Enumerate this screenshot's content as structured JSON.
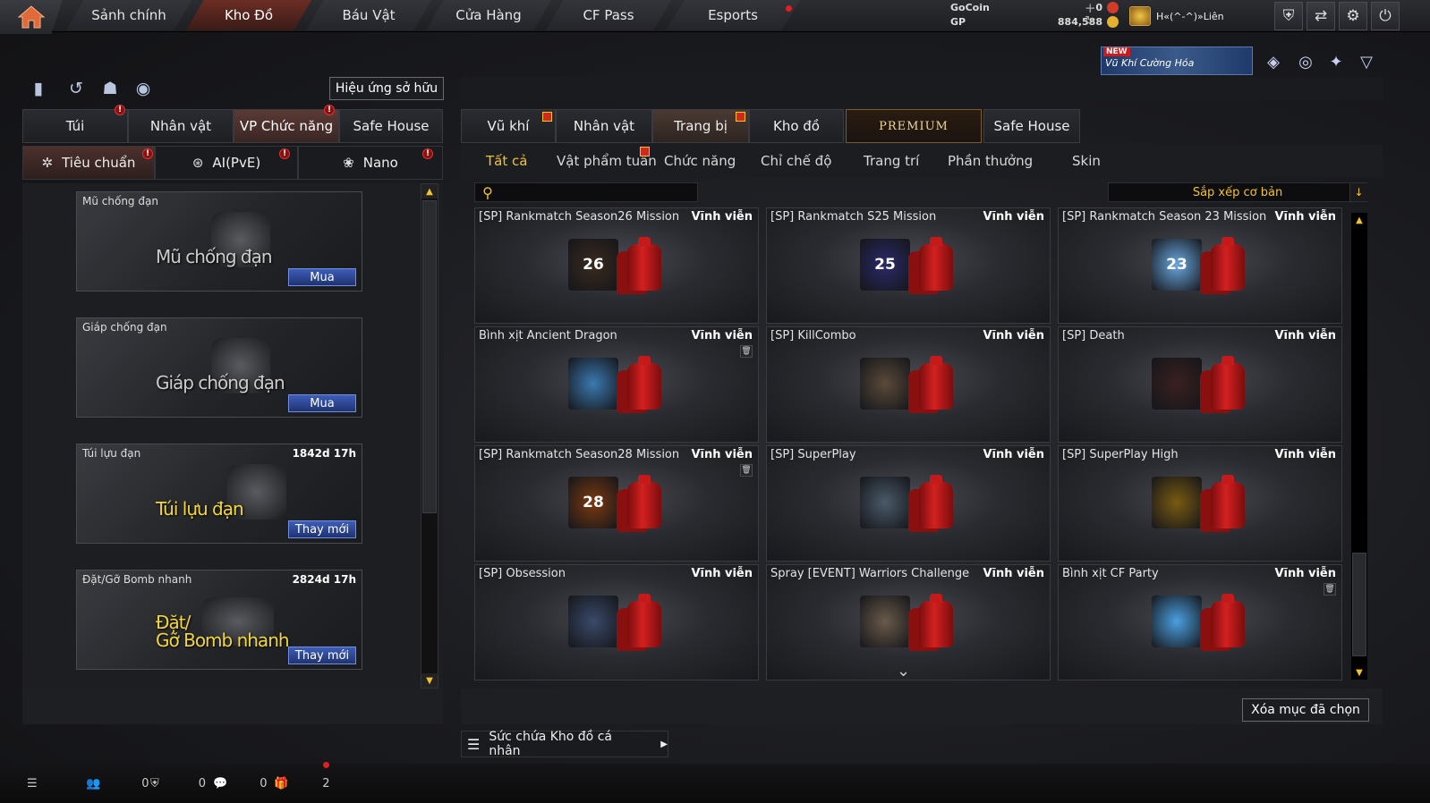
{
  "topnav": {
    "tabs": [
      {
        "label": "Sảnh chính"
      },
      {
        "label": "Kho Đồ"
      },
      {
        "label": "Báu Vật"
      },
      {
        "label": "Cửa Hàng"
      },
      {
        "label": "CF Pass"
      },
      {
        "label": "Esports"
      }
    ],
    "gocoin_label": "GoCoin",
    "gocoin_value": "0",
    "gp_label": "GP",
    "gp_value": "884,588",
    "username": "H«(^-^)»Liên"
  },
  "banner": {
    "new_tag": "NEW",
    "text": "Vũ Khí Cường Hóa"
  },
  "left": {
    "effects_button": "Hiệu ứng sở hữu",
    "tabs": [
      {
        "label": "Túi"
      },
      {
        "label": "Nhân vật"
      },
      {
        "label": "VP Chức năng"
      },
      {
        "label": "Safe House"
      }
    ],
    "subtabs": [
      {
        "label": "Tiêu chuẩn"
      },
      {
        "label": "AI(PvE)"
      },
      {
        "label": "Nano"
      }
    ],
    "items": [
      {
        "name": "Mũ chống đạn",
        "big": "Mũ chống đạn",
        "time": "",
        "action": "Mua"
      },
      {
        "name": "Giáp chống đạn",
        "big": "Giáp chống đạn",
        "time": "",
        "action": "Mua"
      },
      {
        "name": "Túi lựu đạn",
        "big": "Túi lựu đạn",
        "time": "1842d 17h",
        "action": "Thay mới"
      },
      {
        "name": "Đặt/Gỡ Bomb nhanh",
        "big": "Đặt/\nGỡ Bomb nhanh",
        "time": "2824d 17h",
        "action": "Thay mới"
      }
    ]
  },
  "right": {
    "tabs": [
      {
        "label": "Vũ khí"
      },
      {
        "label": "Nhân vật"
      },
      {
        "label": "Trang bị"
      },
      {
        "label": "Kho đồ"
      },
      {
        "label": "PREMIUM"
      },
      {
        "label": "Safe House"
      }
    ],
    "filters": [
      {
        "label": "Tất cả"
      },
      {
        "label": "Vật phẩm tuần"
      },
      {
        "label": "Chức năng"
      },
      {
        "label": "Chỉ chế độ"
      },
      {
        "label": "Trang trí"
      },
      {
        "label": "Phần thưởng"
      },
      {
        "label": "Skin"
      }
    ],
    "search_placeholder": "",
    "sort_label": "Sắp xếp cơ bản",
    "items": [
      {
        "title": "[SP] Rankmatch Season26 Mission",
        "duration": "Vĩnh viễn",
        "badge": "26",
        "color": "#3a2a1e"
      },
      {
        "title": "[SP] Rankmatch S25 Mission",
        "duration": "Vĩnh viễn",
        "badge": "25",
        "color": "#2a2a6a"
      },
      {
        "title": "[SP] Rankmatch Season 23 Mission",
        "duration": "Vĩnh viễn",
        "badge": "23",
        "color": "#6aa8e0"
      },
      {
        "title": "Bình xịt Ancient Dragon",
        "duration": "Vĩnh viễn",
        "badge": "",
        "color": "#3a7ab0"
      },
      {
        "title": "[SP] KillCombo",
        "duration": "Vĩnh viễn",
        "badge": "",
        "color": "#5a4a3a"
      },
      {
        "title": "[SP] Death",
        "duration": "Vĩnh viễn",
        "badge": "",
        "color": "#3a2020"
      },
      {
        "title": "[SP] Rankmatch Season28 Mission",
        "duration": "Vĩnh viễn",
        "badge": "28",
        "color": "#7a3a10"
      },
      {
        "title": "[SP] SuperPlay",
        "duration": "Vĩnh viễn",
        "badge": "",
        "color": "#4a5a6a"
      },
      {
        "title": "[SP] SuperPlay High",
        "duration": "Vĩnh viễn",
        "badge": "",
        "color": "#7a5a10"
      },
      {
        "title": "[SP] Obsession",
        "duration": "Vĩnh viễn",
        "badge": "",
        "color": "#3a4a6a"
      },
      {
        "title": "Spray [EVENT] Warriors Challenge",
        "duration": "Vĩnh viễn",
        "badge": "",
        "color": "#6a5a4a"
      },
      {
        "title": "Bình xịt CF Party",
        "duration": "Vĩnh viễn",
        "badge": "",
        "color": "#4aa0e0"
      }
    ],
    "clear_button": "Xóa mục đã chọn",
    "capacity_label": "Sức chứa Kho đồ cá nhân"
  },
  "statusbar": {
    "friends": "0",
    "clan": "0",
    "messages": "0",
    "gifts": "2"
  }
}
